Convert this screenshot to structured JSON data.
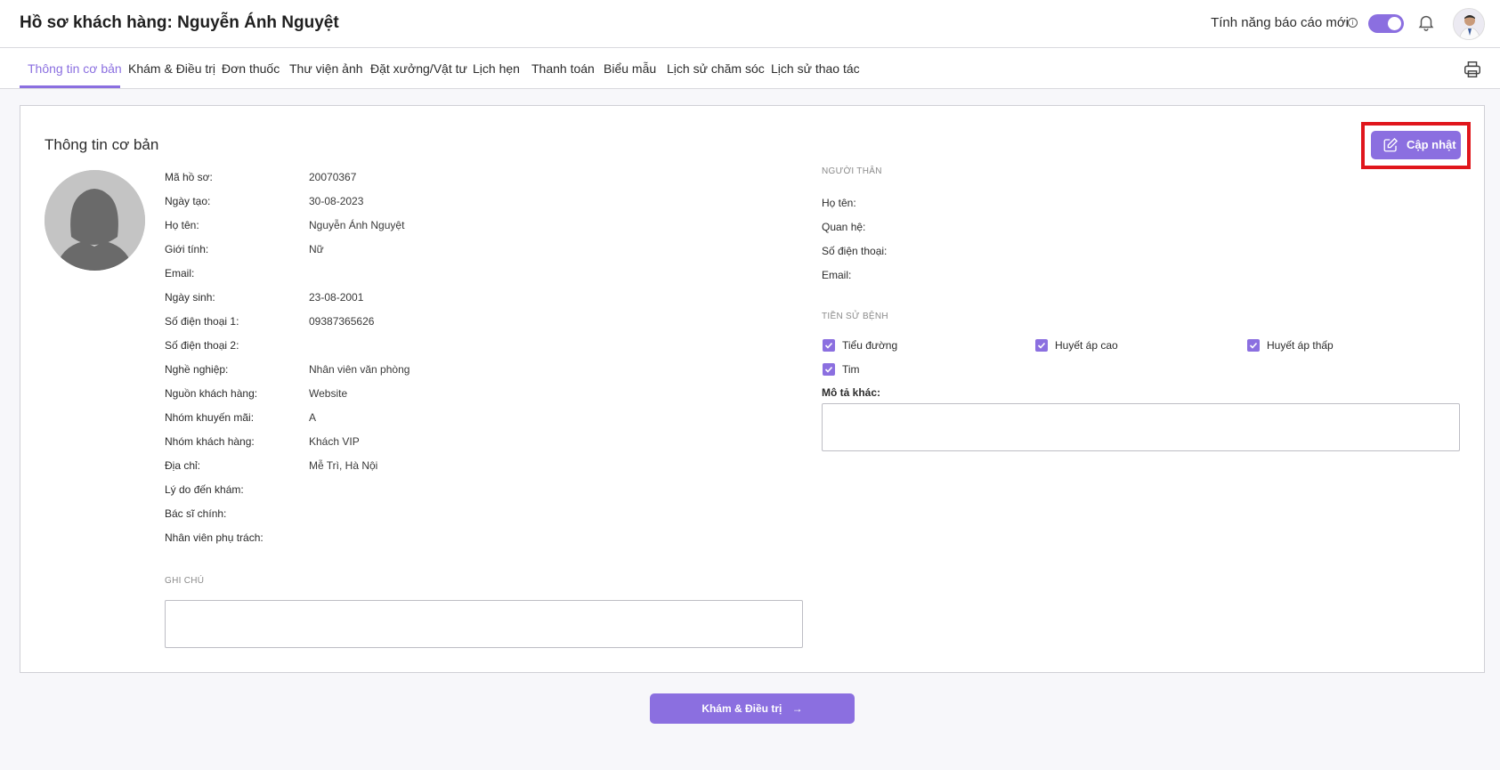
{
  "header": {
    "title": "Hồ sơ khách hàng: Nguyễn Ánh Nguyệt",
    "toggle_label": "Tính năng báo cáo mới",
    "toggle_on": true,
    "accent_color": "#8b6fe0"
  },
  "tabs": [
    {
      "label": "Thông tin cơ bản",
      "active": true
    },
    {
      "label": "Khám & Điều trị"
    },
    {
      "label": "Đơn thuốc"
    },
    {
      "label": "Thư viện ảnh"
    },
    {
      "label": "Đặt xưởng/Vật tư"
    },
    {
      "label": "Lịch hẹn"
    },
    {
      "label": "Thanh toán"
    },
    {
      "label": "Biểu mẫu"
    },
    {
      "label": "Lịch sử chăm sóc"
    },
    {
      "label": "Lịch sử thao tác"
    }
  ],
  "card": {
    "title": "Thông tin cơ bản",
    "update_label": "Cập nhật"
  },
  "fields": [
    {
      "label": "Mã hồ sơ:",
      "value": "20070367"
    },
    {
      "label": "Ngày tạo:",
      "value": "30-08-2023"
    },
    {
      "label": "Họ tên:",
      "value": "Nguyễn Ánh Nguyệt"
    },
    {
      "label": "Giới tính:",
      "value": "Nữ"
    },
    {
      "label": "Email:",
      "value": ""
    },
    {
      "label": "Ngày sinh:",
      "value": "23-08-2001"
    },
    {
      "label": "Số điện thoại 1:",
      "value": "09387365626"
    },
    {
      "label": "Số điện thoại 2:",
      "value": ""
    },
    {
      "label": "Nghề nghiệp:",
      "value": "Nhân viên văn phòng"
    },
    {
      "label": "Nguồn khách hàng:",
      "value": "Website"
    },
    {
      "label": "Nhóm khuyến mãi:",
      "value": "A"
    },
    {
      "label": "Nhóm khách hàng:",
      "value": "Khách VIP"
    },
    {
      "label": "Địa chỉ:",
      "value": "Mễ Trì, Hà Nội"
    },
    {
      "label": "Lý do đến khám:",
      "value": ""
    },
    {
      "label": "Bác sĩ chính:",
      "value": ""
    },
    {
      "label": "Nhân viên phụ trách:",
      "value": ""
    }
  ],
  "notes": {
    "section_label": "GHI CHÚ",
    "value": ""
  },
  "relatives": {
    "section_label": "NGƯỜI THÂN",
    "fields": [
      "Họ tên:",
      "Quan hệ:",
      "Số điện thoại:",
      "Email:"
    ]
  },
  "history": {
    "section_label": "TIỀN SỬ BỆNH",
    "items": [
      {
        "label": "Tiểu đường",
        "checked": true
      },
      {
        "label": "Huyết áp cao",
        "checked": true
      },
      {
        "label": "Huyết áp thấp",
        "checked": true
      },
      {
        "label": "Tim",
        "checked": true
      }
    ],
    "desc_label": "Mô tả khác:",
    "desc_value": ""
  },
  "footer": {
    "next_label": "Khám & Điều trị"
  }
}
